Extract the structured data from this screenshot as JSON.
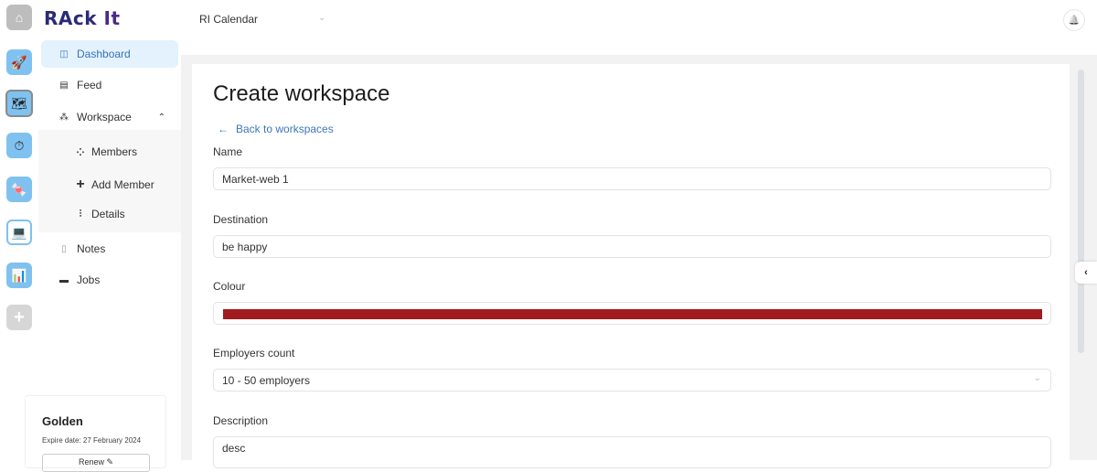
{
  "app": {
    "logo_text_main": "RAck ",
    "logo_text_accent": "It"
  },
  "rail": {
    "items": [
      {
        "name": "home",
        "icon": "house-icon",
        "glyph": "⌂"
      },
      {
        "name": "app-1",
        "icon": "rocket-app-icon",
        "glyph": "🚀"
      },
      {
        "name": "app-2",
        "icon": "map-app-icon",
        "glyph": "🗺"
      },
      {
        "name": "app-3",
        "icon": "clock-app-icon",
        "glyph": "⏱"
      },
      {
        "name": "app-4",
        "icon": "candy-app-icon",
        "glyph": "🍬"
      },
      {
        "name": "app-5",
        "icon": "laptop-app-icon",
        "glyph": "💻"
      },
      {
        "name": "app-6",
        "icon": "chart-app-icon",
        "glyph": "📊"
      },
      {
        "name": "add",
        "icon": "plus-icon",
        "glyph": "+"
      }
    ]
  },
  "sidebar": {
    "items": [
      {
        "label": "Dashboard",
        "icon": "dashboard-icon",
        "glyph": "◫",
        "active": true
      },
      {
        "label": "Feed",
        "icon": "feed-icon",
        "glyph": "▤"
      },
      {
        "label": "Workspace",
        "icon": "workspace-icon",
        "glyph": "⁂",
        "expanded": true,
        "chevron": "⌃"
      },
      {
        "label": "Notes",
        "icon": "notes-icon",
        "glyph": "▯"
      },
      {
        "label": "Jobs",
        "icon": "briefcase-icon",
        "glyph": "▬"
      }
    ],
    "workspace_sub": [
      {
        "label": "Members",
        "icon": "members-icon",
        "glyph": "⁘"
      },
      {
        "label": "Add Member",
        "icon": "plus-icon",
        "glyph": "+"
      },
      {
        "label": "Details",
        "icon": "details-icon",
        "glyph": "⫶"
      }
    ],
    "plan": {
      "name": "Golden",
      "expire": "Expire date: 27 February 2024",
      "button_label": "Renew ✎"
    }
  },
  "topbar": {
    "calendar_select": "RI Calendar",
    "chevron": "⌄",
    "bell_glyph": "🔔"
  },
  "form": {
    "title": "Create workspace",
    "back_arrow": "←",
    "back_label": "Back to workspaces",
    "name_label": "Name",
    "name_value": "Market-web 1",
    "destination_label": "Destination",
    "destination_value": "be happy",
    "colour_label": "Colour",
    "colour_value": "#a31a1f",
    "employers_label": "Employers count",
    "employers_value": "10 - 50 employers",
    "description_label": "Description",
    "description_value": "desc"
  },
  "collapse_glyph": "‹"
}
